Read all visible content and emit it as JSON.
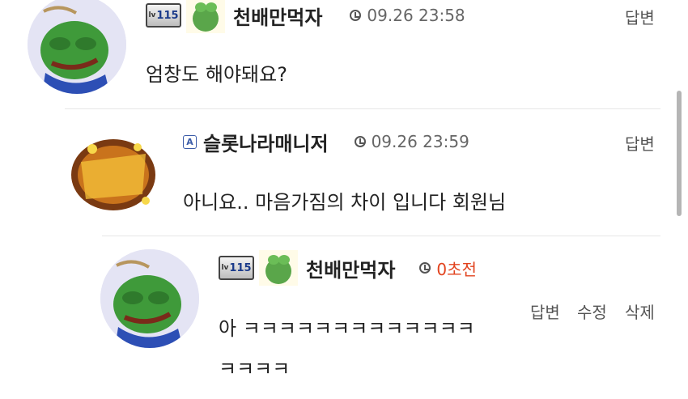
{
  "comments": [
    {
      "author": "천배만먹자",
      "level": "115",
      "level_prefix": "lv",
      "time": "09.26 23:58",
      "text": "엄창도 해야돼요?",
      "actions": [
        "답변"
      ]
    },
    {
      "author": "슬롯나라매니저",
      "role_badge": "A",
      "time": "09.26 23:59",
      "text": "아니요.. 마음가짐의 차이 입니다 회원님",
      "actions": [
        "답변"
      ]
    },
    {
      "author": "천배만먹자",
      "level": "115",
      "level_prefix": "lv",
      "time": "0초전",
      "text_line1": "아 ㅋㅋㅋㅋㅋㅋㅋㅋㅋㅋㅋㅋㅋ",
      "text_line2": "ㅋㅋㅋㅋ",
      "actions": [
        "답변",
        "수정",
        "삭제"
      ]
    }
  ],
  "colors": {
    "new_time": "#e2431e",
    "divider": "#e6e6e6",
    "text": "#222222"
  },
  "icons": {
    "clock": "clock-icon",
    "level": "level-badge-icon",
    "avatar": "frog-avatar"
  }
}
